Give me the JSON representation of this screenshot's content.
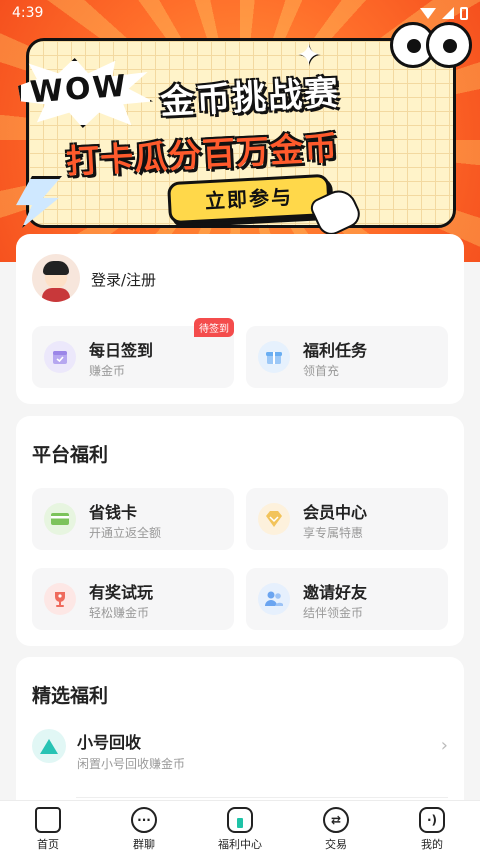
{
  "status_bar": {
    "time": "4:39"
  },
  "banner": {
    "burst_text": "WOW",
    "title_line1": "金币挑战赛",
    "title_line2": "打卡瓜分百万金币",
    "cta": "立即参与"
  },
  "user": {
    "login_text": "登录/注册"
  },
  "quick_tiles": [
    {
      "title": "每日签到",
      "subtitle": "赚金币",
      "badge": "待签到",
      "icon": "calendar-check-icon",
      "icon_bg": "#ece8fb",
      "icon_color": "#9b86e8"
    },
    {
      "title": "福利任务",
      "subtitle": "领首充",
      "icon": "gift-icon",
      "icon_bg": "#e6f1fd",
      "icon_color": "#6aaef2"
    }
  ],
  "platform": {
    "title": "平台福利",
    "items": [
      {
        "title": "省钱卡",
        "subtitle": "开通立返全额",
        "icon": "card-icon",
        "icon_bg": "#e7f5e0",
        "icon_color": "#7cc35b"
      },
      {
        "title": "会员中心",
        "subtitle": "享专属特惠",
        "icon": "diamond-icon",
        "icon_bg": "#fdf1dc",
        "icon_color": "#f2c35a"
      },
      {
        "title": "有奖试玩",
        "subtitle": "轻松赚金币",
        "icon": "trophy-icon",
        "icon_bg": "#fde7e5",
        "icon_color": "#ef6a5c"
      },
      {
        "title": "邀请好友",
        "subtitle": "结伴领金币",
        "icon": "users-icon",
        "icon_bg": "#e6f0fd",
        "icon_color": "#6aa4f0"
      }
    ]
  },
  "featured": {
    "title": "精选福利",
    "items": [
      {
        "title": "小号回收",
        "subtitle": "闲置小号回收赚金币",
        "icon": "recycle-icon"
      }
    ]
  },
  "bottom_nav": [
    {
      "label": "首页",
      "icon": "home-icon"
    },
    {
      "label": "群聊",
      "icon": "chat-icon"
    },
    {
      "label": "福利中心",
      "icon": "gift-box-icon"
    },
    {
      "label": "交易",
      "icon": "exchange-icon"
    },
    {
      "label": "我的",
      "icon": "profile-icon"
    }
  ],
  "colors": {
    "accent": "#1fc3a7",
    "badge": "#f44c4c",
    "banner_orange": "#ff6e2a"
  }
}
